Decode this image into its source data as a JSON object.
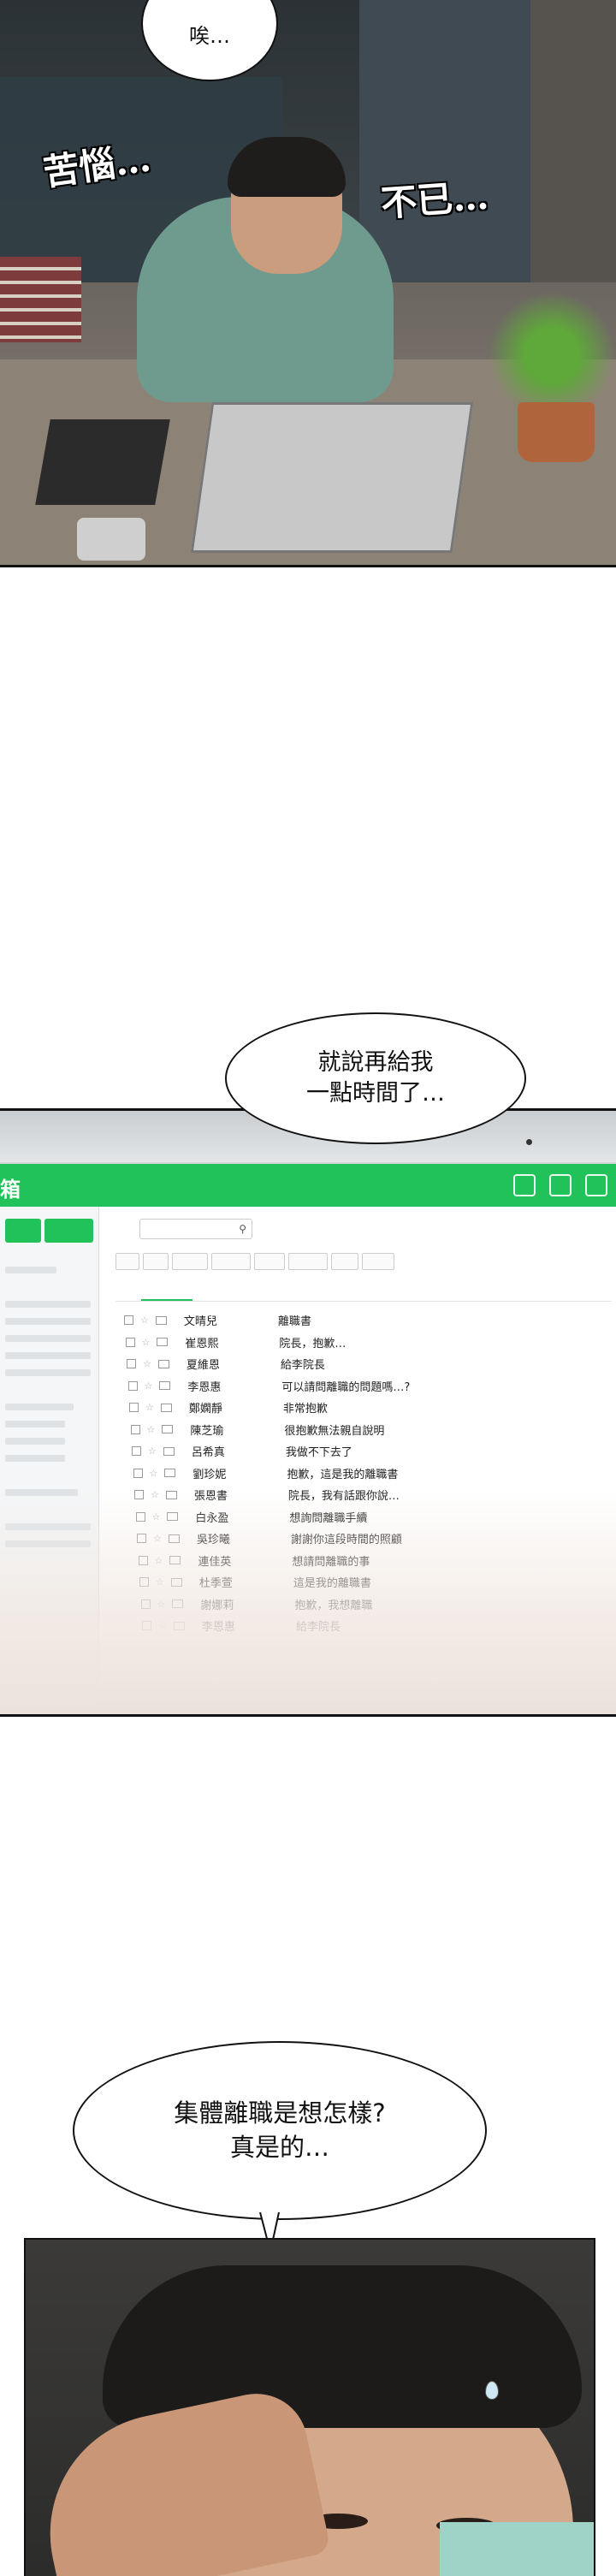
{
  "panel1": {
    "bubble_text": "唉…",
    "sfx_left": "苦惱…",
    "sfx_right": "不已…"
  },
  "speech2": {
    "line1": "就說再給我",
    "line2": "一點時間了…"
  },
  "mail_app": {
    "title": "箱",
    "rows": [
      {
        "sender": "文晴兒",
        "subject": "離職書"
      },
      {
        "sender": "崔恩熙",
        "subject": "院長，抱歉…"
      },
      {
        "sender": "夏維恩",
        "subject": "給李院長"
      },
      {
        "sender": "李恩惠",
        "subject": "可以請問離職的問題嗎…?"
      },
      {
        "sender": "鄭嫻靜",
        "subject": "非常抱歉"
      },
      {
        "sender": "陳芝瑜",
        "subject": "很抱歉無法親自說明"
      },
      {
        "sender": "呂希真",
        "subject": "我做不下去了"
      },
      {
        "sender": "劉珍妮",
        "subject": "抱歉，這是我的離職書"
      },
      {
        "sender": "張恩書",
        "subject": "院長，我有話跟你說…"
      },
      {
        "sender": "白永盈",
        "subject": "想詢問離職手續"
      },
      {
        "sender": "吳珍曦",
        "subject": "謝謝你這段時間的照顧"
      },
      {
        "sender": "連佳英",
        "subject": "想請問離職的事"
      },
      {
        "sender": "杜季萱",
        "subject": "這是我的離職書"
      },
      {
        "sender": "謝娜莉",
        "subject": "抱歉，我想離職"
      },
      {
        "sender": "李恩惠",
        "subject": "給李院長"
      }
    ]
  },
  "speech3": {
    "line1": "集體離職是想怎樣?",
    "line2": "真是的…"
  },
  "colors": {
    "mail_green": "#22c25a"
  }
}
